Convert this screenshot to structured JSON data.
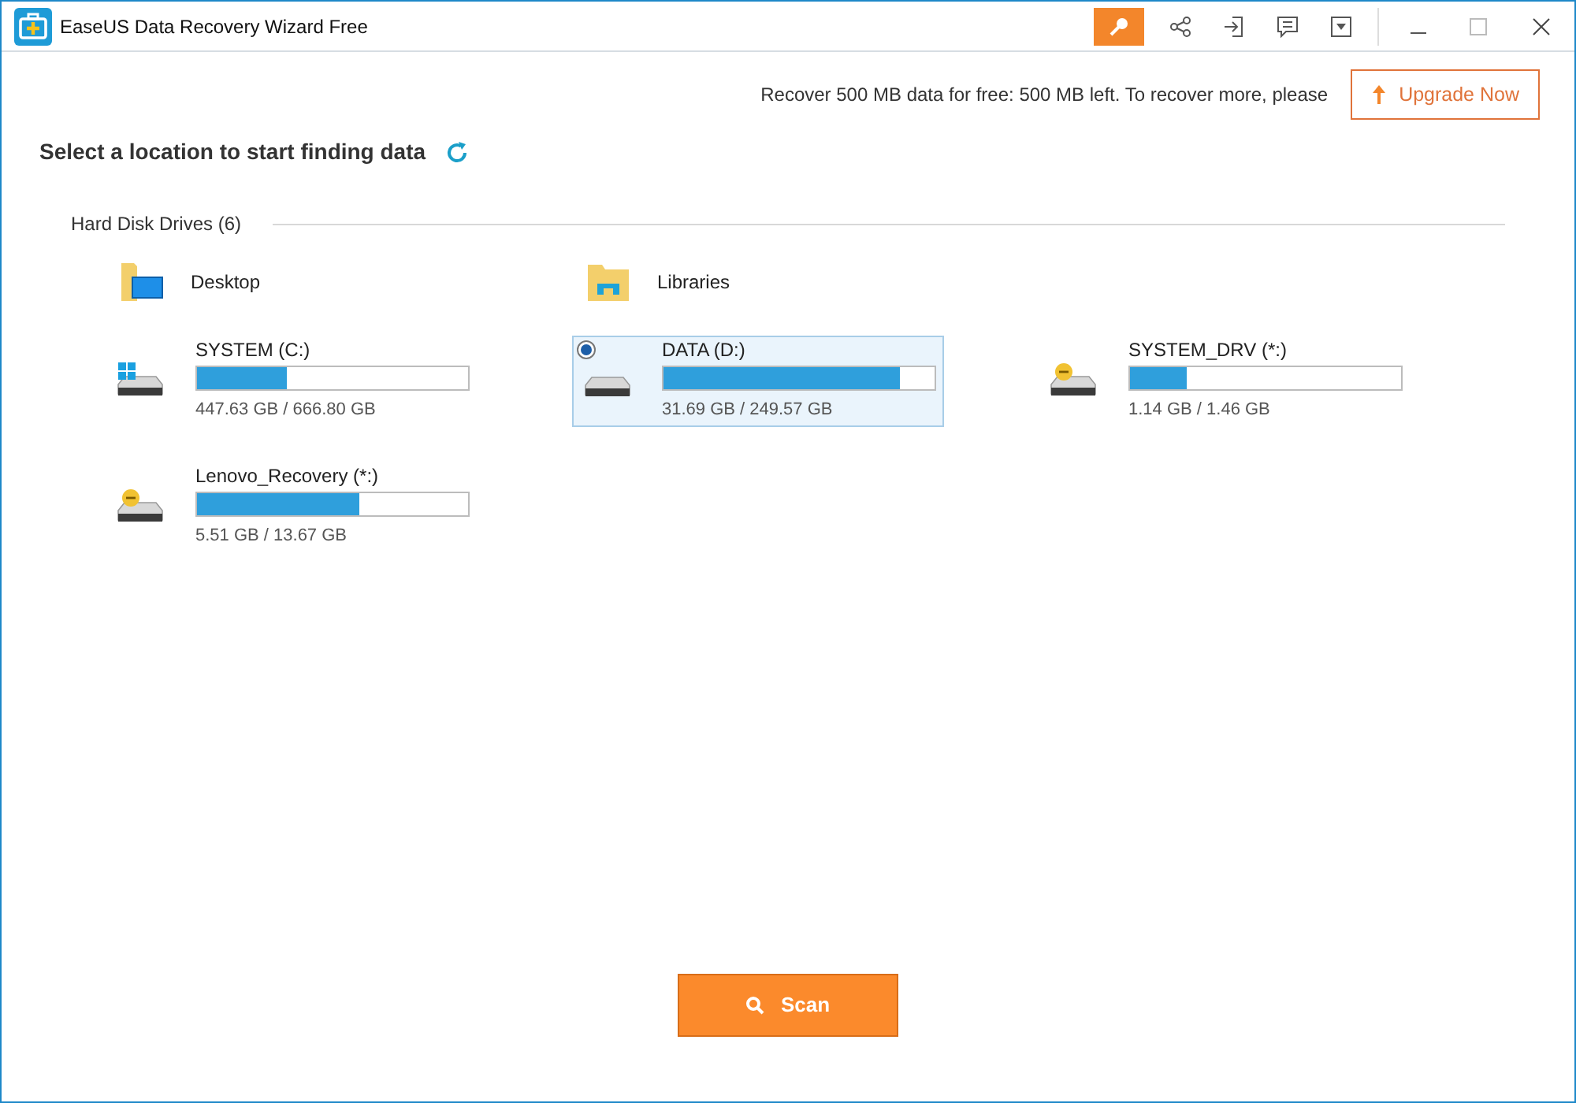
{
  "window": {
    "title": "EaseUS Data Recovery Wizard Free"
  },
  "notice": {
    "text": "Recover 500 MB data for free: 500 MB left. To recover more, please",
    "button": "Upgrade Now"
  },
  "heading": "Select a location to start finding data",
  "section": {
    "label": "Hard Disk Drives (6)"
  },
  "places": [
    {
      "kind": "desktop",
      "label": "Desktop"
    },
    {
      "kind": "libraries",
      "label": "Libraries"
    }
  ],
  "drives": [
    {
      "kind": "windows",
      "name": "SYSTEM (C:)",
      "level": 0.33,
      "usage": "447.63 GB / 666.80 GB",
      "selected": false
    },
    {
      "kind": "plain",
      "name": "DATA (D:)",
      "level": 0.87,
      "usage": "31.69 GB / 249.57 GB",
      "selected": true
    },
    {
      "kind": "warning",
      "name": "SYSTEM_DRV (*:)",
      "level": 0.21,
      "usage": "1.14 GB / 1.46 GB",
      "selected": false
    },
    {
      "kind": "warning",
      "name": "Lenovo_Recovery (*:)",
      "level": 0.6,
      "usage": "5.51 GB / 13.67 GB",
      "selected": false
    }
  ],
  "scan_button": "Scan"
}
